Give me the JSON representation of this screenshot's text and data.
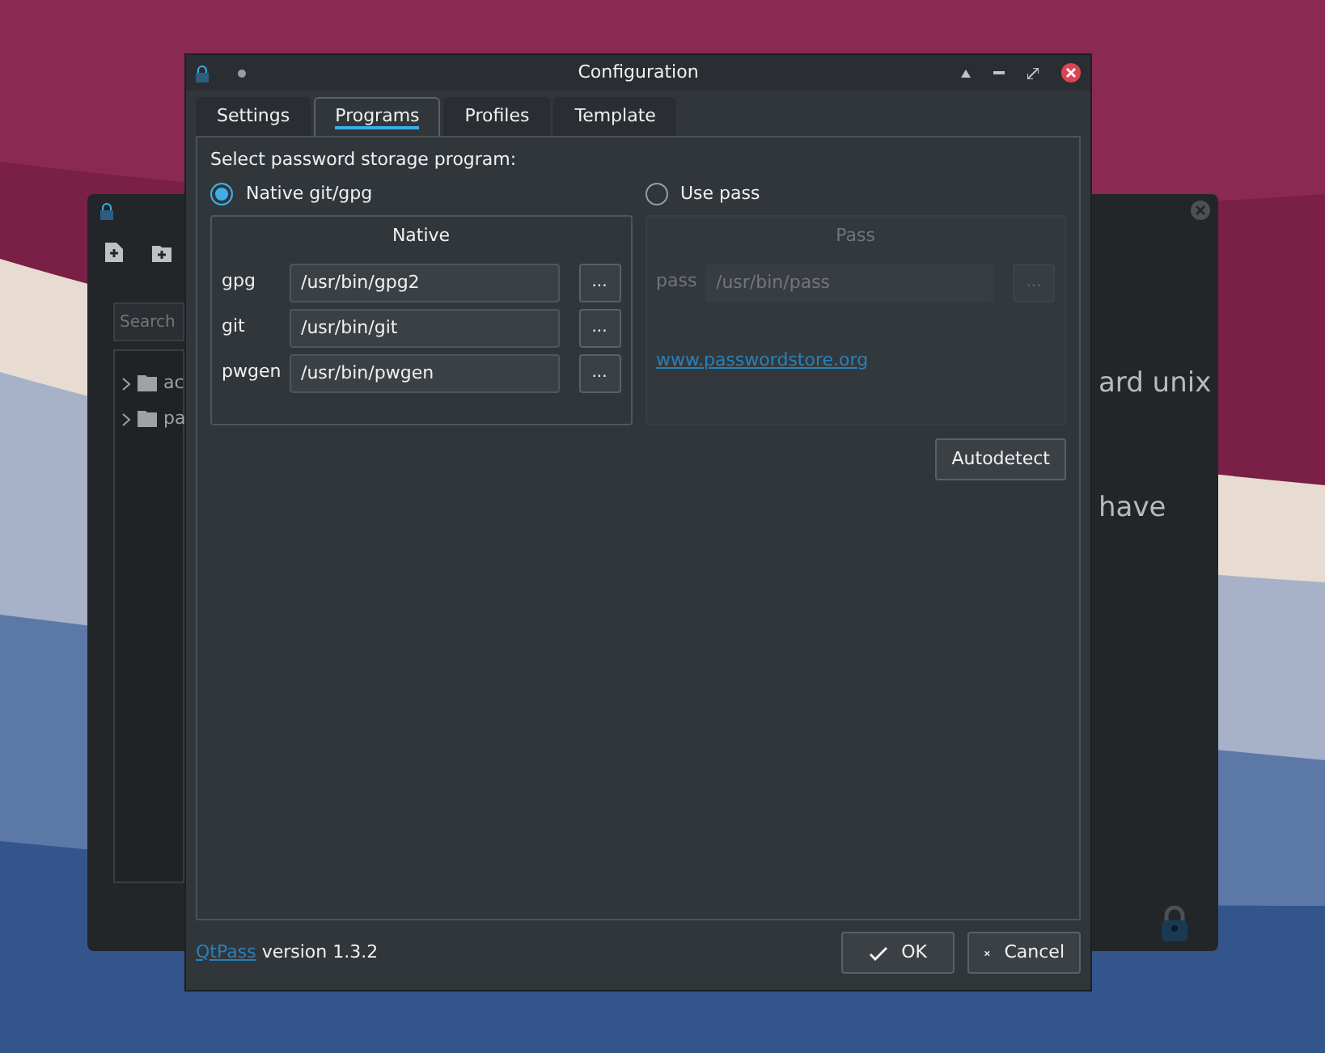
{
  "background_window": {
    "search": {
      "placeholder": "Search"
    },
    "tree": [
      {
        "label": "ac"
      },
      {
        "label": "pa"
      }
    ],
    "text_lines": [
      "ard unix",
      "have"
    ]
  },
  "dialog": {
    "title": "Configuration",
    "tabs": [
      {
        "label": "Settings",
        "selected": false
      },
      {
        "label": "Programs",
        "selected": true
      },
      {
        "label": "Profiles",
        "selected": false
      },
      {
        "label": "Template",
        "selected": false
      }
    ],
    "prompt": "Select password storage program:",
    "options": [
      {
        "label": "Native git/gpg",
        "selected": true
      },
      {
        "label": "Use pass",
        "selected": false
      }
    ],
    "groups": [
      {
        "title": "Native",
        "disabled": false,
        "rows": [
          {
            "label": "gpg",
            "value": "/usr/bin/gpg2",
            "button": "..."
          },
          {
            "label": "git",
            "value": "/usr/bin/git",
            "button": "..."
          },
          {
            "label": "pwgen",
            "value": "/usr/bin/pwgen",
            "button": "..."
          }
        ]
      },
      {
        "title": "Pass",
        "disabled": true,
        "rows": [
          {
            "label": "pass",
            "value": "/usr/bin/pass",
            "button": "..."
          }
        ],
        "link": "www.passwordstore.org"
      }
    ],
    "autodetect": "Autodetect",
    "footer": {
      "link": "QtPass",
      "text": "version 1.3.2"
    },
    "buttons": [
      {
        "label": "OK",
        "kind": "ok"
      },
      {
        "label": "Cancel",
        "kind": "cancel"
      }
    ]
  }
}
